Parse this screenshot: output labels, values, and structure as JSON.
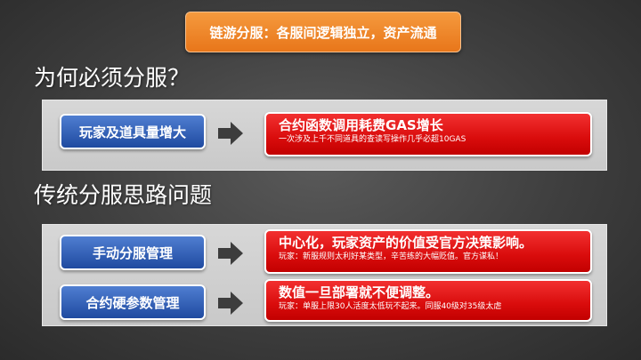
{
  "banner": "链游分服：各服间逻辑独立，资产流通",
  "section1": {
    "title": "为何必须分服？",
    "rows": [
      {
        "label": "玩家及道具量增大",
        "headline": "合约函数调用耗费GAS增长",
        "detail": "一次涉及上千不同道具的查读写操作几乎必超10GAS"
      }
    ]
  },
  "section2": {
    "title": "传统分服思路问题",
    "rows": [
      {
        "label": "手动分服管理",
        "headline": "中心化，玩家资产的价值受官方决策影响。",
        "detail": "玩家：新服规则太利好某类型，辛苦练的大幅贬值。官方谋私！"
      },
      {
        "label": "合约硬参数管理",
        "headline": "数值一旦部署就不便调整。",
        "detail": "玩家：单服上限30人活度太低玩不起来。同服40级对35级太虐"
      }
    ]
  },
  "colors": {
    "banner": "#ed8426",
    "blue_box": "#2c5bb5",
    "red_box": "#e01010",
    "arrow": "#3d3d3d",
    "panel": "#d0d0d0"
  },
  "icons": {
    "arrow": "right-arrow-icon"
  }
}
